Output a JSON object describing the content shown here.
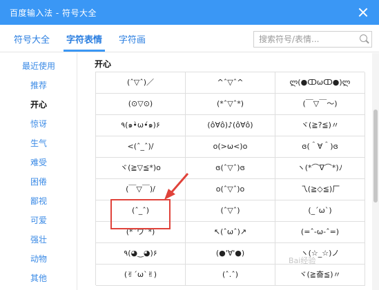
{
  "window": {
    "title": "百度输入法 - 符号大全"
  },
  "tabs": [
    {
      "label": "符号大全"
    },
    {
      "label": "字符表情"
    },
    {
      "label": "字符画"
    }
  ],
  "search": {
    "placeholder": "搜索符号/表情..."
  },
  "sidebar": {
    "items": [
      {
        "label": "最近使用"
      },
      {
        "label": "推荐"
      },
      {
        "label": "开心"
      },
      {
        "label": "惊讶"
      },
      {
        "label": "生气"
      },
      {
        "label": "难受"
      },
      {
        "label": "困倦"
      },
      {
        "label": "鄙视"
      },
      {
        "label": "可爱"
      },
      {
        "label": "强壮"
      },
      {
        "label": "动物"
      },
      {
        "label": "其他"
      }
    ],
    "active_index": 2
  },
  "section": {
    "title": "开心"
  },
  "emoticons": [
    [
      "(ˆ▽ˆ)／",
      "^ˆ▽ˆ^",
      "ლ(●ↀωↀ●)ლ"
    ],
    [
      "(⊙▽⊙)",
      "(*ˆ▽ˆ*)",
      "(￣▽￣～)"
    ],
    [
      "٩(๑•̀ω•́๑)۶",
      "(ô∀ô)♪(ô∀ô)",
      "ヾ(≧?≦)〃"
    ],
    [
      "<(ˆ_ˆ)/",
      "o(>ω<)o",
      "ɞ(＾∀＾)ɞ"
    ],
    [
      "ヾ(≧▽≦*)o",
      "ɞ(ˆ▽ˆ)ɞ",
      "ヽ(*⌒∇⌒*)ﾉ"
    ],
    [
      "(￣▽￣)/",
      "o(ˆ▽ˆ)o",
      "乁(≧◇≦)厂"
    ],
    [
      "(ˆ_ˆ)",
      "(ˆ▽ˆ)",
      "(_ˊωˋ)"
    ],
    [
      "(*ˆワˆ*)",
      "↖(ˆωˆ)↗",
      "(=ˆ-ω-ˆ=)"
    ],
    [
      "٩(◕‿◕)۶",
      "(●'∀'●)",
      "ヽ(☆_☆)ノ"
    ],
    [
      "(✌ˊωˋ✌)",
      "(ˆ.ˆ)",
      "ヾ(≧奋≦)〃"
    ]
  ],
  "colors": {
    "titlebar": "#3a97f5",
    "link": "#3a8ae6",
    "highlight": "#e0423a"
  },
  "icons": {
    "close": "close-icon",
    "search": "search-icon",
    "arrow": "red-arrow-annotation"
  },
  "watermark": {
    "text": "Bai经验"
  }
}
